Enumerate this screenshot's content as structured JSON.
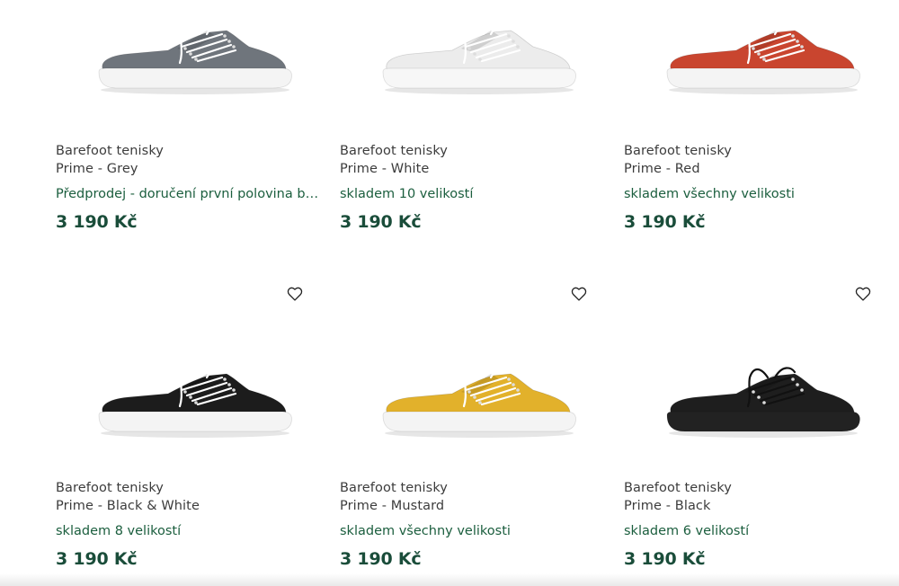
{
  "products": [
    {
      "line1": "Barefoot tenisky",
      "line2": "Prime - Grey",
      "stock": "Předprodej - doručení první polovina březn",
      "price": "3 190 Kč",
      "upper_color": "#6f757c",
      "sole_color": "#f4f4f4",
      "lace_color": "#ffffff",
      "show_wishlist": false
    },
    {
      "line1": "Barefoot tenisky",
      "line2": "Prime - White",
      "stock": "skladem 10 velikostí",
      "price": "3 190 Kč",
      "upper_color": "#ececec",
      "sole_color": "#f7f7f7",
      "lace_color": "#ffffff",
      "show_wishlist": false
    },
    {
      "line1": "Barefoot tenisky",
      "line2": "Prime - Red",
      "stock": "skladem všechny velikosti",
      "price": "3 190 Kč",
      "upper_color": "#c9452f",
      "sole_color": "#f4f4f4",
      "lace_color": "#ffffff",
      "show_wishlist": false
    },
    {
      "line1": "Barefoot tenisky",
      "line2": "Prime - Black & White",
      "stock": "skladem 8 velikostí",
      "price": "3 190 Kč",
      "upper_color": "#1c1c1c",
      "sole_color": "#f4f4f4",
      "lace_color": "#ffffff",
      "show_wishlist": true
    },
    {
      "line1": "Barefoot tenisky",
      "line2": "Prime - Mustard",
      "stock": "skladem všechny velikosti",
      "price": "3 190 Kč",
      "upper_color": "#e2b12b",
      "sole_color": "#f4f4f4",
      "lace_color": "#ffffff",
      "show_wishlist": true
    },
    {
      "line1": "Barefoot tenisky",
      "line2": "Prime - Black",
      "stock": "skladem 6 velikostí",
      "price": "3 190 Kč",
      "upper_color": "#1e1e1e",
      "sole_color": "#222222",
      "lace_color": "#111111",
      "show_wishlist": true
    }
  ],
  "icons": {
    "wishlist": "heart-outline-icon"
  },
  "colors": {
    "stock_text": "#1b5e3e",
    "price_text": "#1a4d3a",
    "name_text": "#3c3c3c"
  }
}
